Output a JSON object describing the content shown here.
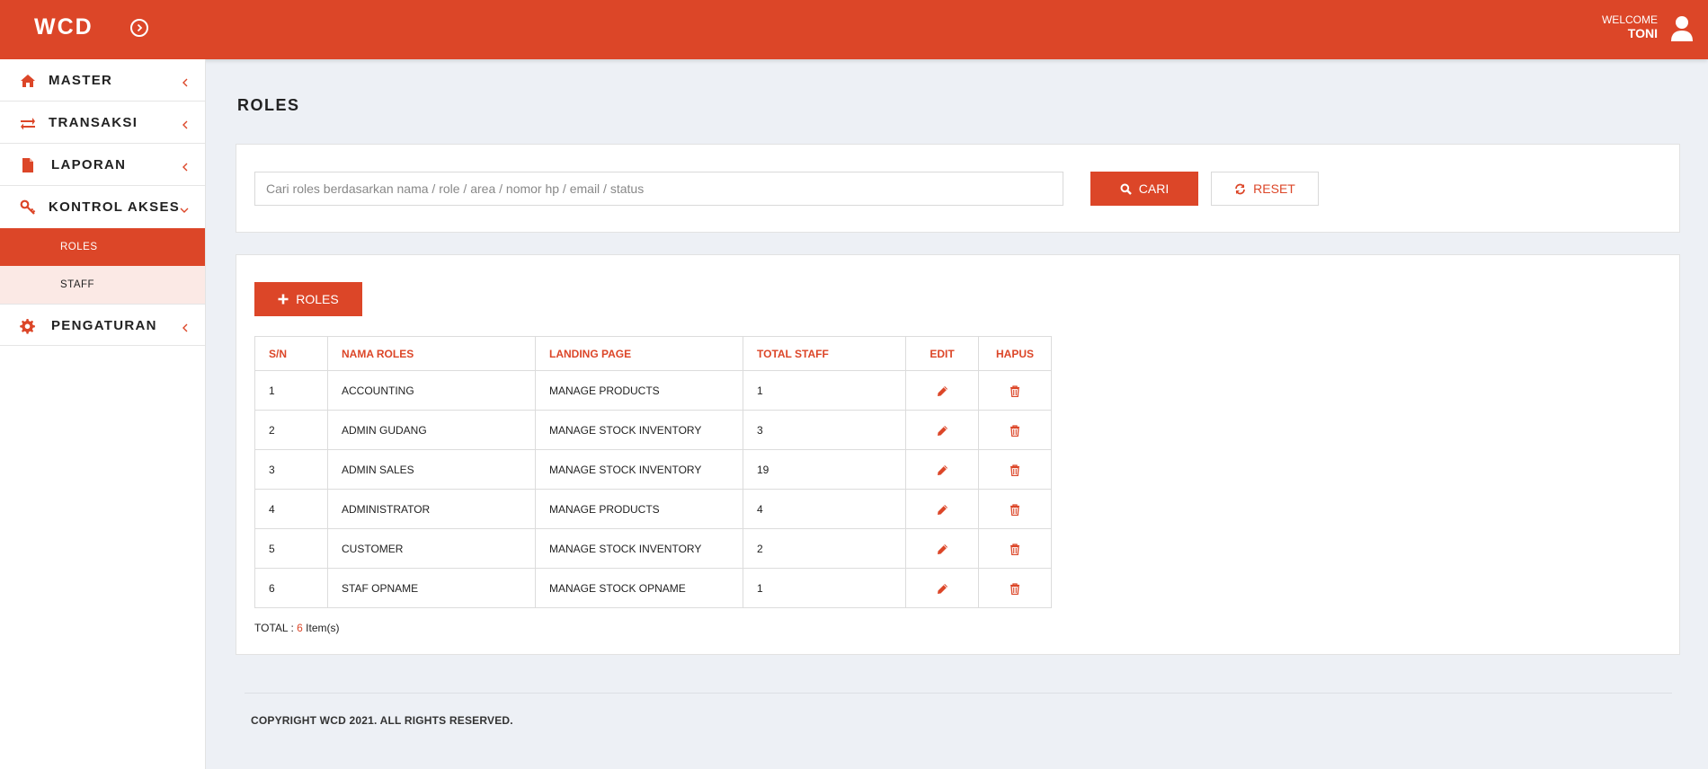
{
  "header": {
    "brand": "WCD",
    "welcome_label": "WELCOME",
    "user_name": "TONI"
  },
  "colors": {
    "accent": "#dc4628",
    "accent_light": "#fbe9e5",
    "background": "#edf0f5"
  },
  "sidebar": {
    "items": [
      {
        "label": "MASTER",
        "icon": "home-icon"
      },
      {
        "label": "TRANSAKSI",
        "icon": "exchange-icon"
      },
      {
        "label": "LAPORAN",
        "icon": "file-icon"
      },
      {
        "label": "KONTROL AKSES",
        "icon": "key-icon",
        "expanded": true,
        "subitems": [
          {
            "label": "ROLES",
            "active": true
          },
          {
            "label": "STAFF"
          }
        ]
      },
      {
        "label": "PENGATURAN",
        "icon": "gear-icon"
      }
    ]
  },
  "main": {
    "title": "ROLES",
    "search": {
      "placeholder": "Cari roles berdasarkan nama / role / area / nomor hp / email / status",
      "value": "",
      "search_button": "CARI",
      "reset_button": "RESET"
    },
    "add_button": "ROLES",
    "table": {
      "headers": [
        "S/N",
        "NAMA ROLES",
        "LANDING PAGE",
        "TOTAL STAFF",
        "EDIT",
        "HAPUS"
      ],
      "rows": [
        {
          "sn": "1",
          "name": "ACCOUNTING",
          "landing": "MANAGE PRODUCTS",
          "total": "1"
        },
        {
          "sn": "2",
          "name": "ADMIN GUDANG",
          "landing": "MANAGE STOCK INVENTORY",
          "total": "3"
        },
        {
          "sn": "3",
          "name": "ADMIN SALES",
          "landing": "MANAGE STOCK INVENTORY",
          "total": "19"
        },
        {
          "sn": "4",
          "name": "ADMINISTRATOR",
          "landing": "MANAGE PRODUCTS",
          "total": "4"
        },
        {
          "sn": "5",
          "name": "CUSTOMER",
          "landing": "MANAGE STOCK INVENTORY",
          "total": "2"
        },
        {
          "sn": "6",
          "name": "STAF OPNAME",
          "landing": "MANAGE STOCK OPNAME",
          "total": "1"
        }
      ]
    },
    "total": {
      "prefix": "TOTAL :",
      "count": "6",
      "suffix": "Item(s)"
    }
  },
  "footer": {
    "copyright": "COPYRIGHT WCD 2021. ALL RIGHTS RESERVED."
  }
}
